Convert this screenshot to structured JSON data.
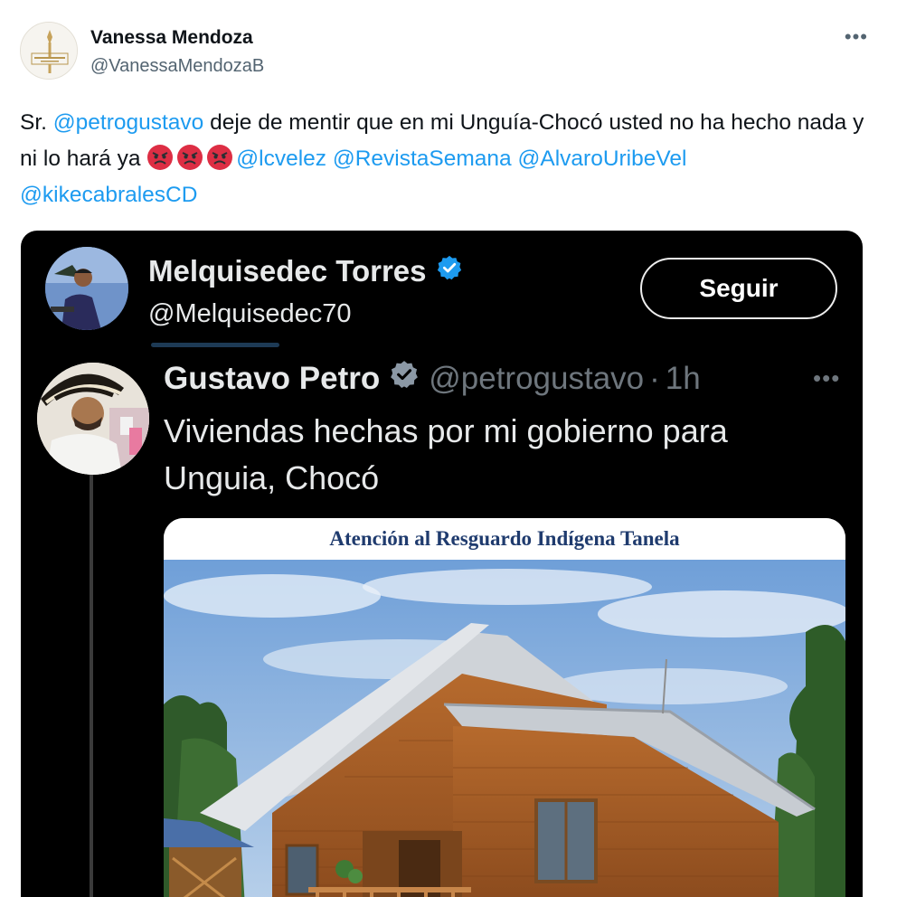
{
  "tweet": {
    "author_name": "Vanessa Mendoza",
    "author_handle": "@VanessaMendozaB",
    "more_label": "•••",
    "text": {
      "part1": "Sr. ",
      "mention1": "@petrogustavo",
      "part2": " deje de mentir que en mi Unguía-Chocó usted no ha hecho nada y ni lo hará ya ",
      "emojis": [
        "angry-face-icon",
        "angry-face-icon",
        "angry-face-icon"
      ],
      "mentions_after": [
        "@lcvelez",
        "@RevistaSemana",
        "@AlvaroUribeVel",
        "@kikecabralesCD"
      ]
    }
  },
  "embed": {
    "profile_name": "Melquisedec Torres",
    "profile_handle": "@Melquisedec70",
    "follow_label": "Seguir",
    "quoted": {
      "name": "Gustavo Petro",
      "handle": "@petrogustavo",
      "separator": "·",
      "time": "1h",
      "more_label": "•••",
      "text": "Viviendas hechas por mi gobierno para Unguia, Chocó",
      "image_caption": "Atención al Resguardo Indígena Tanela"
    }
  },
  "colors": {
    "link": "#1d9bf0",
    "verified": "#1d9bf0",
    "embed_bg": "#000000"
  }
}
